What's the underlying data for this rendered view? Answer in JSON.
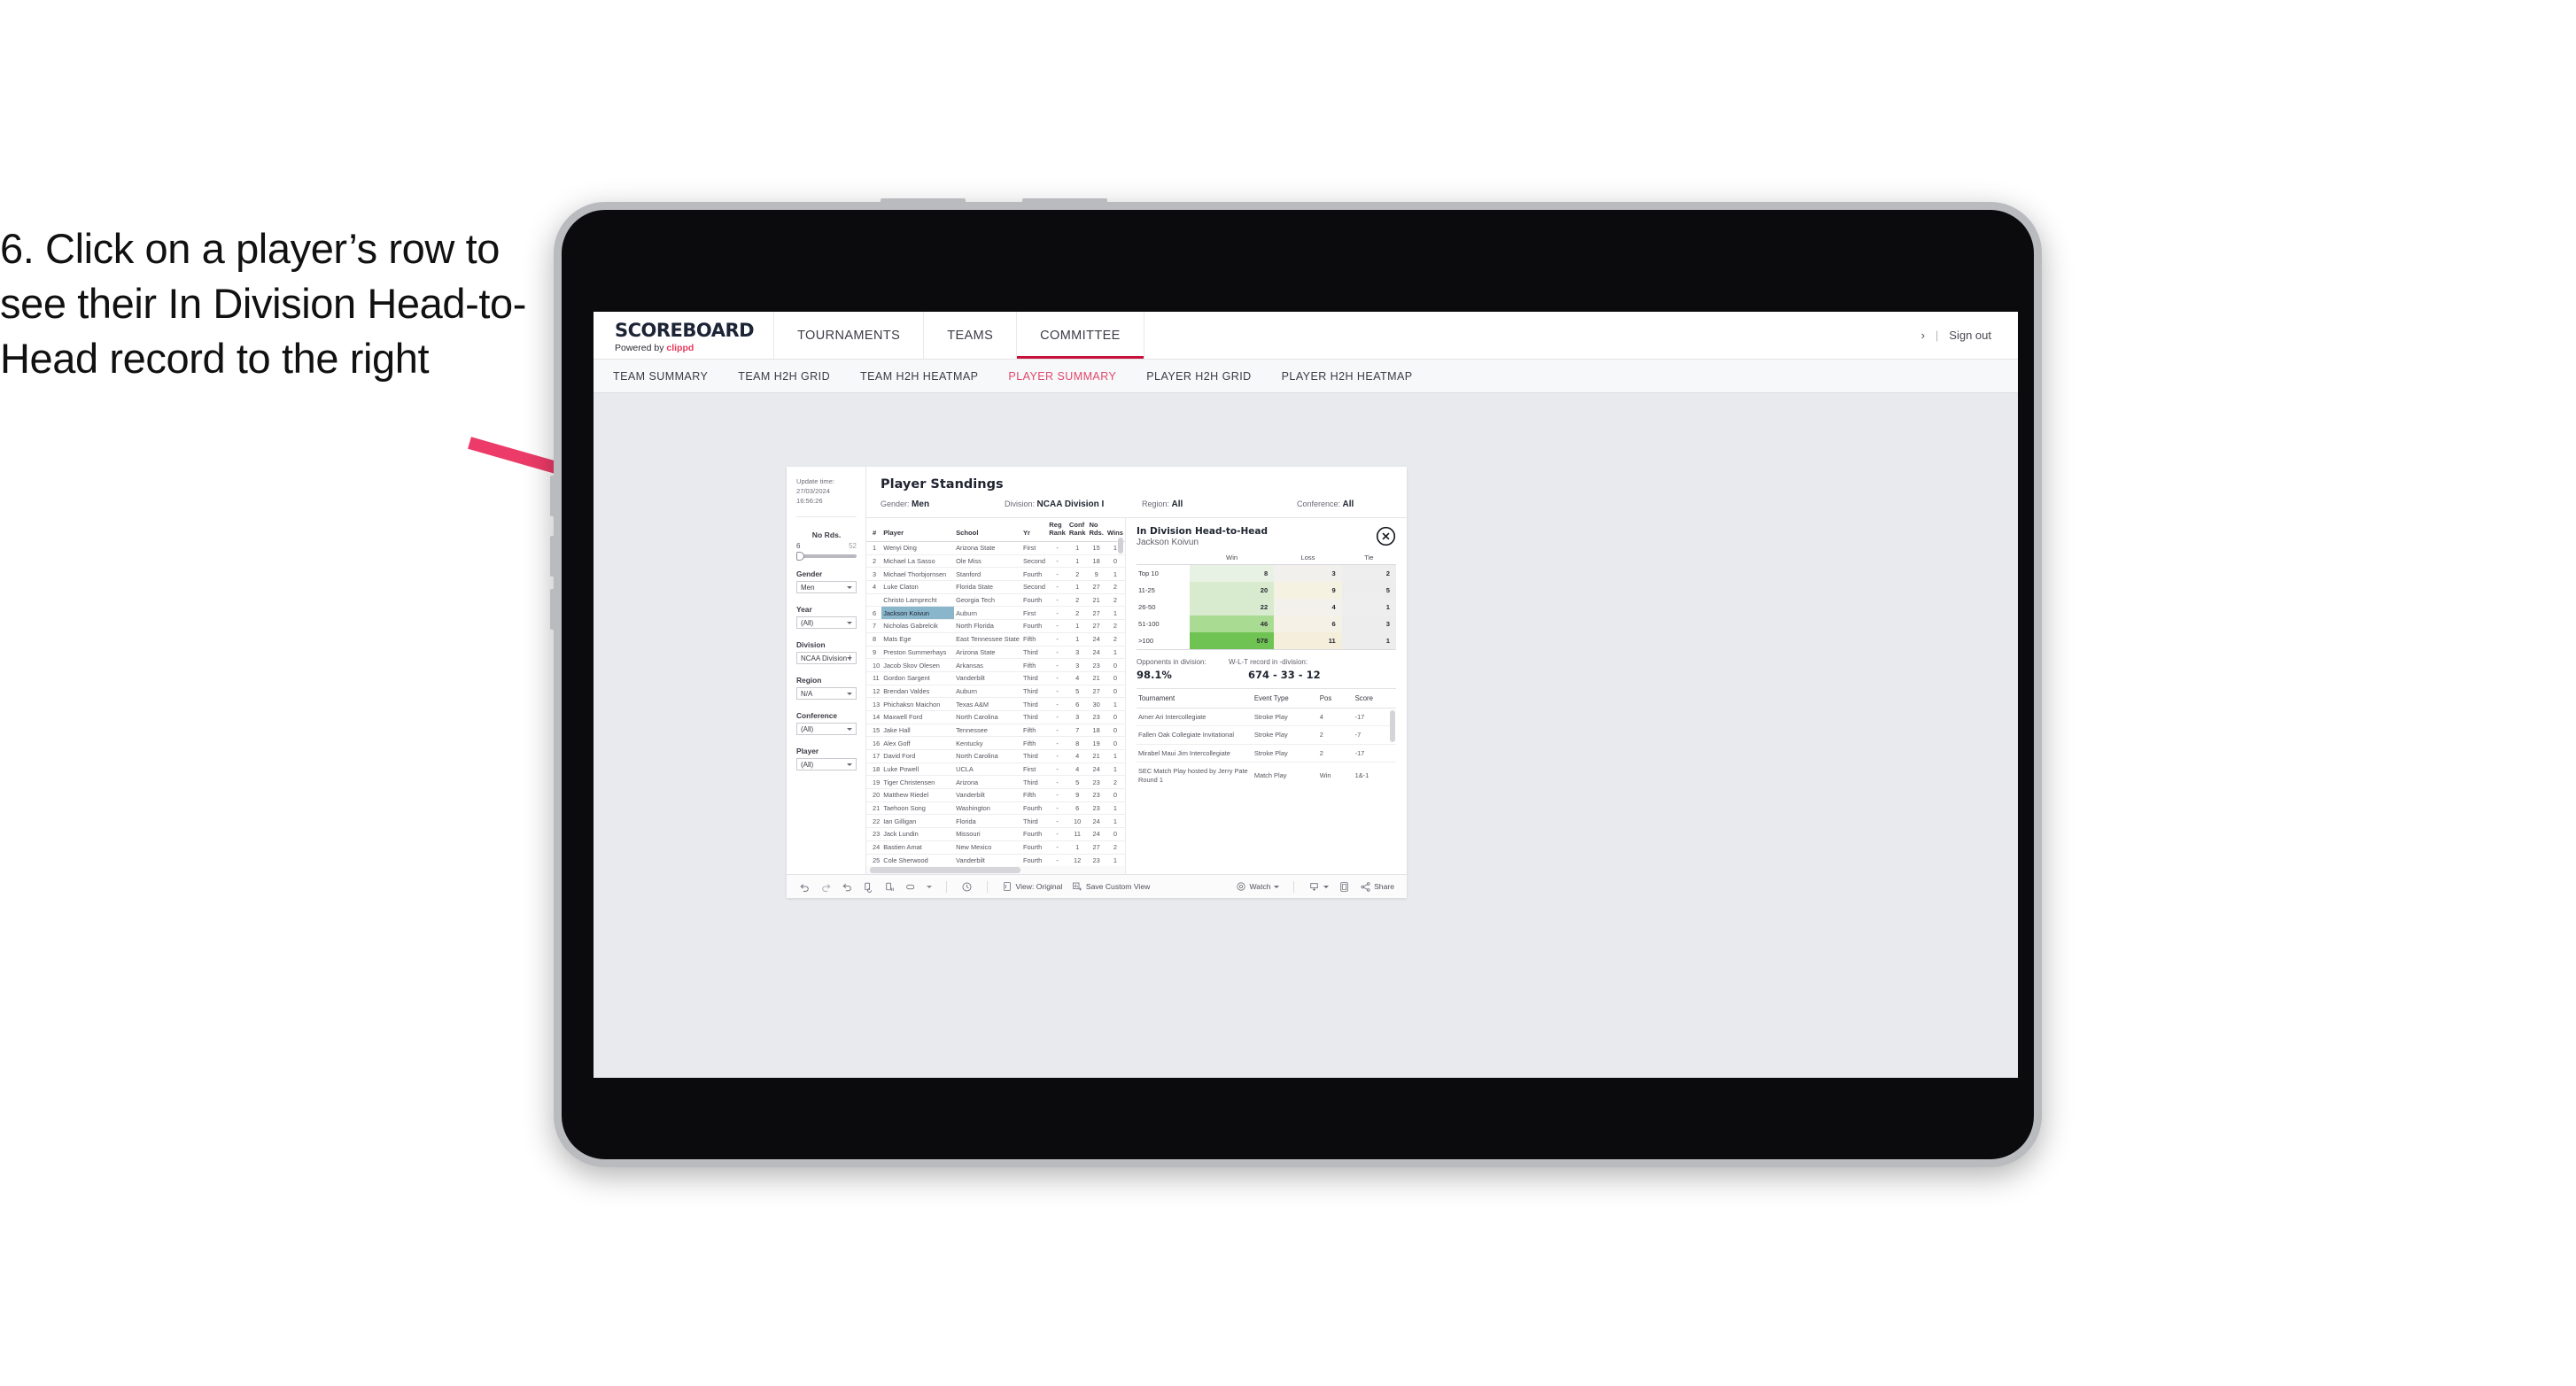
{
  "instruction": {
    "text": "6. Click on a player’s row to see their In Division Head-to-Head record to the right"
  },
  "colors": {
    "accent_pink": "#e0486c",
    "accent_red": "#c8103c",
    "arrow": "#ec3b68",
    "selection_blue": "#8ab6cc",
    "win_green": "#6fc353"
  },
  "header": {
    "brand_title": "SCOREBOARD",
    "brand_sub_prefix": "Powered by ",
    "brand_sub_name": "clippd",
    "nav": [
      {
        "label": "TOURNAMENTS",
        "active": false
      },
      {
        "label": "TEAMS",
        "active": false
      },
      {
        "label": "COMMITTEE",
        "active": true
      }
    ],
    "chevron": "›",
    "separator": "|",
    "sign_out": "Sign out"
  },
  "sub_nav": [
    {
      "label": "TEAM SUMMARY",
      "active": false
    },
    {
      "label": "TEAM H2H GRID",
      "active": false
    },
    {
      "label": "TEAM H2H HEATMAP",
      "active": false
    },
    {
      "label": "PLAYER SUMMARY",
      "active": true
    },
    {
      "label": "PLAYER H2H GRID",
      "active": false
    },
    {
      "label": "PLAYER H2H HEATMAP",
      "active": false
    }
  ],
  "filters": {
    "update_time_label": "Update time:",
    "update_time_value": "27/03/2024 16:56:26",
    "slider": {
      "title": "No Rds.",
      "min": "6",
      "max": "52"
    },
    "selects": [
      {
        "label": "Gender",
        "value": "Men"
      },
      {
        "label": "Year",
        "value": "(All)"
      },
      {
        "label": "Division",
        "value": "NCAA Division I"
      },
      {
        "label": "Region",
        "value": "N/A"
      },
      {
        "label": "Conference",
        "value": "(All)"
      },
      {
        "label": "Player",
        "value": "(All)"
      }
    ]
  },
  "standings": {
    "title": "Player Standings",
    "context": [
      {
        "label": "Gender:",
        "value": "Men"
      },
      {
        "label": "Division:",
        "value": "NCAA Division I"
      },
      {
        "label": "Region:",
        "value": "All"
      },
      {
        "label": "Conference:",
        "value": "All"
      }
    ],
    "columns": [
      "#",
      "Player",
      "School",
      "Yr",
      "Reg Rank",
      "Conf Rank",
      "No Rds.",
      "Wins"
    ],
    "rows": [
      {
        "rank": "1",
        "player": "Wenyi Ding",
        "school": "Arizona State",
        "yr": "First",
        "reg": "-",
        "conf": "1",
        "rds": "15",
        "wins": "1",
        "selected": false
      },
      {
        "rank": "2",
        "player": "Michael La Sasso",
        "school": "Ole Miss",
        "yr": "Second",
        "reg": "-",
        "conf": "1",
        "rds": "18",
        "wins": "0",
        "selected": false
      },
      {
        "rank": "3",
        "player": "Michael Thorbjornsen",
        "school": "Stanford",
        "yr": "Fourth",
        "reg": "-",
        "conf": "2",
        "rds": "9",
        "wins": "1",
        "selected": false
      },
      {
        "rank": "4",
        "player": "Luke Claton",
        "school": "Florida State",
        "yr": "Second",
        "reg": "-",
        "conf": "1",
        "rds": "27",
        "wins": "2",
        "selected": false
      },
      {
        "rank": "",
        "player": "Christo Lamprecht",
        "school": "Georgia Tech",
        "yr": "Fourth",
        "reg": "-",
        "conf": "2",
        "rds": "21",
        "wins": "2",
        "selected": false
      },
      {
        "rank": "6",
        "player": "Jackson Koivun",
        "school": "Auburn",
        "yr": "First",
        "reg": "-",
        "conf": "2",
        "rds": "27",
        "wins": "1",
        "selected": true
      },
      {
        "rank": "7",
        "player": "Nicholas Gabrelcik",
        "school": "North Florida",
        "yr": "Fourth",
        "reg": "-",
        "conf": "1",
        "rds": "27",
        "wins": "2",
        "selected": false
      },
      {
        "rank": "8",
        "player": "Mats Ege",
        "school": "East Tennessee State",
        "yr": "Fifth",
        "reg": "-",
        "conf": "1",
        "rds": "24",
        "wins": "2",
        "selected": false
      },
      {
        "rank": "9",
        "player": "Preston Summerhays",
        "school": "Arizona State",
        "yr": "Third",
        "reg": "-",
        "conf": "3",
        "rds": "24",
        "wins": "1",
        "selected": false
      },
      {
        "rank": "10",
        "player": "Jacob Skov Olesen",
        "school": "Arkansas",
        "yr": "Fifth",
        "reg": "-",
        "conf": "3",
        "rds": "23",
        "wins": "0",
        "selected": false
      },
      {
        "rank": "11",
        "player": "Gordon Sargent",
        "school": "Vanderbilt",
        "yr": "Third",
        "reg": "-",
        "conf": "4",
        "rds": "21",
        "wins": "0",
        "selected": false
      },
      {
        "rank": "12",
        "player": "Brendan Valdes",
        "school": "Auburn",
        "yr": "Third",
        "reg": "-",
        "conf": "5",
        "rds": "27",
        "wins": "0",
        "selected": false
      },
      {
        "rank": "13",
        "player": "Phichaksn Maichon",
        "school": "Texas A&M",
        "yr": "Third",
        "reg": "-",
        "conf": "6",
        "rds": "30",
        "wins": "1",
        "selected": false
      },
      {
        "rank": "14",
        "player": "Maxwell Ford",
        "school": "North Carolina",
        "yr": "Third",
        "reg": "-",
        "conf": "3",
        "rds": "23",
        "wins": "0",
        "selected": false
      },
      {
        "rank": "15",
        "player": "Jake Hall",
        "school": "Tennessee",
        "yr": "Fifth",
        "reg": "-",
        "conf": "7",
        "rds": "18",
        "wins": "0",
        "selected": false
      },
      {
        "rank": "16",
        "player": "Alex Goff",
        "school": "Kentucky",
        "yr": "Fifth",
        "reg": "-",
        "conf": "8",
        "rds": "19",
        "wins": "0",
        "selected": false
      },
      {
        "rank": "17",
        "player": "David Ford",
        "school": "North Carolina",
        "yr": "Third",
        "reg": "-",
        "conf": "4",
        "rds": "21",
        "wins": "1",
        "selected": false
      },
      {
        "rank": "18",
        "player": "Luke Powell",
        "school": "UCLA",
        "yr": "First",
        "reg": "-",
        "conf": "4",
        "rds": "24",
        "wins": "1",
        "selected": false
      },
      {
        "rank": "19",
        "player": "Tiger Christensen",
        "school": "Arizona",
        "yr": "Third",
        "reg": "-",
        "conf": "5",
        "rds": "23",
        "wins": "2",
        "selected": false
      },
      {
        "rank": "20",
        "player": "Matthew Riedel",
        "school": "Vanderbilt",
        "yr": "Fifth",
        "reg": "-",
        "conf": "9",
        "rds": "23",
        "wins": "0",
        "selected": false
      },
      {
        "rank": "21",
        "player": "Taehoon Song",
        "school": "Washington",
        "yr": "Fourth",
        "reg": "-",
        "conf": "6",
        "rds": "23",
        "wins": "1",
        "selected": false
      },
      {
        "rank": "22",
        "player": "Ian Gilligan",
        "school": "Florida",
        "yr": "Third",
        "reg": "-",
        "conf": "10",
        "rds": "24",
        "wins": "1",
        "selected": false
      },
      {
        "rank": "23",
        "player": "Jack Lundin",
        "school": "Missouri",
        "yr": "Fourth",
        "reg": "-",
        "conf": "11",
        "rds": "24",
        "wins": "0",
        "selected": false
      },
      {
        "rank": "24",
        "player": "Bastien Amat",
        "school": "New Mexico",
        "yr": "Fourth",
        "reg": "-",
        "conf": "1",
        "rds": "27",
        "wins": "2",
        "selected": false
      },
      {
        "rank": "25",
        "player": "Cole Sherwood",
        "school": "Vanderbilt",
        "yr": "Fourth",
        "reg": "-",
        "conf": "12",
        "rds": "23",
        "wins": "1",
        "selected": false
      }
    ]
  },
  "h2h": {
    "title": "In Division Head-to-Head",
    "player": "Jackson Koivun",
    "close_icon": "close-circle-icon",
    "columns": [
      "",
      "Win",
      "Loss",
      "Tie"
    ],
    "rows": [
      {
        "bucket": "Top 10",
        "win": "8",
        "loss": "3",
        "tie": "2",
        "win_bg": "#e8f2e4",
        "loss_bg": "#f1f0ec",
        "tie_bg": "#eeeeee"
      },
      {
        "bucket": "11-25",
        "win": "20",
        "loss": "9",
        "tie": "5",
        "win_bg": "#d8ebcf",
        "loss_bg": "#f6f2e2",
        "tie_bg": "#ededed"
      },
      {
        "bucket": "26-50",
        "win": "22",
        "loss": "4",
        "tie": "1",
        "win_bg": "#d8ebcf",
        "loss_bg": "#f2f1ec",
        "tie_bg": "#eeeeee"
      },
      {
        "bucket": "51-100",
        "win": "46",
        "loss": "6",
        "tie": "3",
        "win_bg": "#a9db92",
        "loss_bg": "#f5f1e6",
        "tie_bg": "#ededed"
      },
      {
        "bucket": ">100",
        "win": "578",
        "loss": "11",
        "tie": "1",
        "win_bg": "#6fc353",
        "loss_bg": "#f4eeda",
        "tie_bg": "#ededed"
      }
    ],
    "summary": {
      "opponents_label": "Opponents in division:",
      "opponents_value": "98.1%",
      "record_label": "W-L-T record in -division:",
      "record_value": "674 - 33 - 12"
    },
    "tournament_columns": [
      "Tournament",
      "Event Type",
      "Pos",
      "Score"
    ],
    "tournaments": [
      {
        "name": "Amer Ari Intercollegiate",
        "type": "Stroke Play",
        "pos": "4",
        "score": "-17"
      },
      {
        "name": "Fallen Oak Collegiate Invitational",
        "type": "Stroke Play",
        "pos": "2",
        "score": "-7"
      },
      {
        "name": "Mirabel Maui Jim Intercollegiate",
        "type": "Stroke Play",
        "pos": "2",
        "score": "-17"
      },
      {
        "name": "SEC Match Play hosted by Jerry Pate Round 1",
        "type": "Match Play",
        "pos": "Win",
        "score": "1&-1"
      }
    ]
  },
  "toolbar": {
    "undo": "undo-icon",
    "redo": "redo-icon",
    "revert": "revert-icon",
    "refresh": "refresh-data-icon",
    "pause": "pause-updates-icon",
    "highlight": "highlight-icon",
    "history": "history-icon",
    "view_label": "View: Original",
    "save_label": "Save Custom View",
    "watch_label": "Watch",
    "download": "download-icon",
    "fullscreen": "fullscreen-icon",
    "share_label": "Share"
  }
}
